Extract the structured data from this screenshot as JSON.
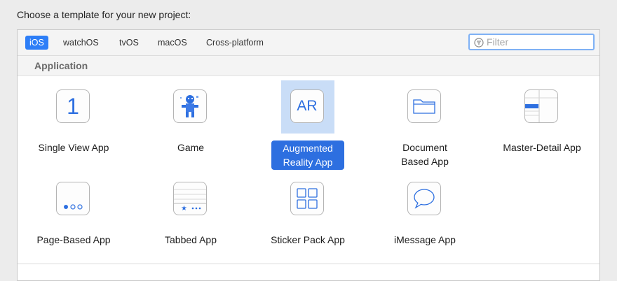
{
  "prompt": "Choose a template for your new project:",
  "platform_tabs": [
    {
      "label": "iOS",
      "active": true
    },
    {
      "label": "watchOS",
      "active": false
    },
    {
      "label": "tvOS",
      "active": false
    },
    {
      "label": "macOS",
      "active": false
    },
    {
      "label": "Cross-platform",
      "active": false
    }
  ],
  "filter": {
    "placeholder": "Filter",
    "value": ""
  },
  "section_title": "Application",
  "templates": [
    {
      "label": "Single View App",
      "icon": "number-one-icon",
      "glyph": "1"
    },
    {
      "label": "Game",
      "icon": "game-sprite-icon"
    },
    {
      "label_line1": "Augmented",
      "label_line2": "Reality App",
      "icon": "ar-icon",
      "glyph": "AR",
      "selected": true
    },
    {
      "label_line1": "Document",
      "label_line2": "Based App",
      "icon": "folder-icon"
    },
    {
      "label": "Master-Detail App",
      "icon": "master-detail-icon"
    },
    {
      "label": "Page-Based App",
      "icon": "page-dots-icon"
    },
    {
      "label": "Tabbed App",
      "icon": "tab-bar-icon"
    },
    {
      "label": "Sticker Pack App",
      "icon": "sticker-grid-icon"
    },
    {
      "label": "iMessage App",
      "icon": "speech-bubble-icon"
    }
  ],
  "colors": {
    "accent": "#2d7ef7",
    "selection_label": "#2d6fe0",
    "selection_highlight": "#c9ddf7"
  }
}
